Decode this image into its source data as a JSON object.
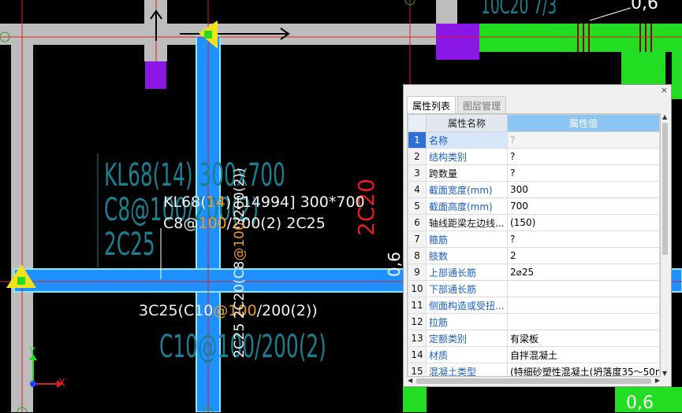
{
  "drawing": {
    "cyan_ghost_lines": [
      "KL68(14) 300x700",
      "C8@100/200(2)",
      "2C25"
    ],
    "cyan_ghost_bottom": "C10@100/200(2)",
    "top_ghost": "10C20 7/3",
    "top_right_dim": "0,6",
    "bottom_right_dim": "0,6",
    "mid_dim": "0,6",
    "red_vertical_text": "2C20",
    "beam_label_line1_a": "KL68(",
    "beam_label_line1_b": "14",
    "beam_label_line1_c": ") [14994] 300*700",
    "beam_label_line2_a": "C8@",
    "beam_label_line2_b": "100",
    "beam_label_line2_c": "/200(2) 2C25",
    "beam_label_line3_a": "3C25(C10",
    "beam_label_line3_b": "@100",
    "beam_label_line3_c": "/200(2))",
    "vertical_label_a": "2C25 2C20(C8",
    "vertical_label_b": "@100",
    "vertical_label_c": "/200(2))",
    "axis_x": "X",
    "axis_y": "Y",
    "colors": {
      "beam_blue": "#1e90ff",
      "wall_gray": "#bdbdbd",
      "green": "#22dd22",
      "purple": "#8a17e6",
      "yellow": "#f3e21b",
      "red_line": "#e02020"
    }
  },
  "panel": {
    "close_icon": "×",
    "tabs": [
      {
        "label": "属性列表",
        "active": true
      },
      {
        "label": "图层管理",
        "active": false
      }
    ],
    "header_name": "属性名称",
    "header_value": "属性值",
    "rows": [
      {
        "num": "1",
        "name": "名称",
        "value": "?",
        "blue": true,
        "gray": true
      },
      {
        "num": "2",
        "name": "结构类别",
        "value": "?",
        "blue": true,
        "gray": false
      },
      {
        "num": "3",
        "name": "跨数量",
        "value": "?",
        "blue": false,
        "gray": false
      },
      {
        "num": "4",
        "name": "截面宽度(mm)",
        "value": "300",
        "blue": true,
        "gray": false
      },
      {
        "num": "5",
        "name": "截面高度(mm)",
        "value": "700",
        "blue": true,
        "gray": false
      },
      {
        "num": "6",
        "name": "轴线距梁左边线...",
        "value": "(150)",
        "blue": false,
        "gray": false
      },
      {
        "num": "7",
        "name": "箍筋",
        "value": "?",
        "blue": true,
        "gray": false
      },
      {
        "num": "8",
        "name": "肢数",
        "value": "2",
        "blue": true,
        "gray": false
      },
      {
        "num": "9",
        "name": "上部通长筋",
        "value": "2⌀25",
        "blue": true,
        "gray": false
      },
      {
        "num": "10",
        "name": "下部通长筋",
        "value": "",
        "blue": true,
        "gray": false
      },
      {
        "num": "11",
        "name": "侧面构造或受扭...",
        "value": "",
        "blue": true,
        "gray": false
      },
      {
        "num": "12",
        "name": "拉筋",
        "value": "",
        "blue": true,
        "gray": false
      },
      {
        "num": "13",
        "name": "定额类别",
        "value": "有梁板",
        "blue": true,
        "gray": false
      },
      {
        "num": "14",
        "name": "材质",
        "value": "自拌混凝土",
        "blue": true,
        "gray": false
      },
      {
        "num": "15",
        "name": "混凝土类型",
        "value": "(特细砂塑性混凝土(坍落度35～50m...",
        "blue": true,
        "gray": false
      }
    ]
  }
}
